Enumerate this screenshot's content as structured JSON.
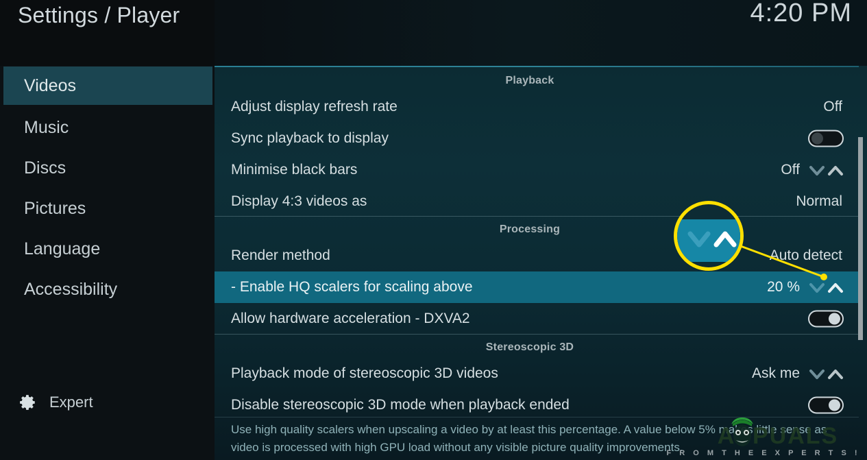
{
  "header": {
    "title": "Settings / Player",
    "clock": "4:20 PM"
  },
  "sidebar": {
    "items": [
      {
        "label": "Videos",
        "selected": true
      },
      {
        "label": "Music",
        "selected": false
      },
      {
        "label": "Discs",
        "selected": false
      },
      {
        "label": "Pictures",
        "selected": false
      },
      {
        "label": "Language",
        "selected": false
      },
      {
        "label": "Accessibility",
        "selected": false
      }
    ],
    "level": {
      "label": "Expert",
      "icon": "gear-icon"
    }
  },
  "content": {
    "groups": [
      {
        "title": "Playback"
      },
      {
        "title": "Processing"
      },
      {
        "title": "Stereoscopic 3D"
      }
    ],
    "settings": [
      {
        "label": "Adjust display refresh rate",
        "value": "Off",
        "control": "value",
        "selected": false
      },
      {
        "label": "Sync playback to display",
        "value": "",
        "control": "toggle",
        "toggle": "off",
        "selected": false
      },
      {
        "label": "Minimise black bars",
        "value": "Off",
        "control": "spinner",
        "selected": false
      },
      {
        "label": "Display 4:3 videos as",
        "value": "Normal",
        "control": "value",
        "selected": false
      },
      {
        "label": "Render method",
        "value": "Auto detect",
        "control": "value",
        "selected": false
      },
      {
        "label": "- Enable HQ scalers for scaling above",
        "value": "20 %",
        "control": "spinner",
        "selected": true
      },
      {
        "label": "Allow hardware acceleration - DXVA2",
        "value": "",
        "control": "toggle",
        "toggle": "on",
        "selected": false
      },
      {
        "label": "Playback mode of stereoscopic 3D videos",
        "value": "Ask me",
        "control": "spinner",
        "selected": false
      },
      {
        "label": "Disable stereoscopic 3D mode when playback ended",
        "value": "",
        "control": "toggle",
        "toggle": "on",
        "selected": false
      }
    ],
    "description": "Use high quality scalers when upscaling a video by at least this percentage. A value below 5% makes little sense as video is processed with high GPU load without any visible picture quality improvements."
  },
  "annotation": {
    "magnifier_target": "value-spinner-chevrons",
    "highlight_color": "#ffe000"
  },
  "watermark": {
    "brand": "APPUALS",
    "tagline": "F R O M   T H E   E X P E R T S !"
  },
  "colors": {
    "selected_row": "#11687f",
    "sidebar_selected": "#1b4551",
    "accent": "#2a7f93",
    "annotation": "#ffe000"
  }
}
